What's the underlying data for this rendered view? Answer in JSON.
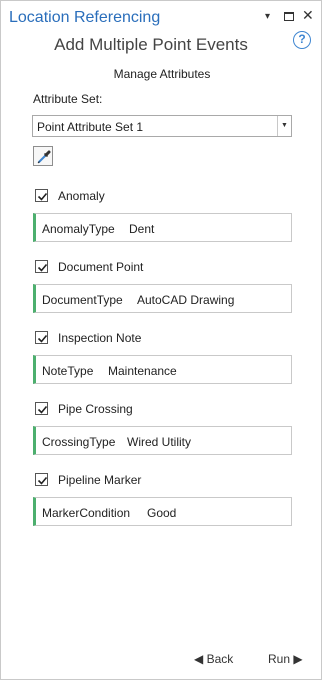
{
  "pane": {
    "title": "Location Referencing",
    "menu_glyph": "▾",
    "close_glyph": "✕"
  },
  "tool": {
    "title": "Add Multiple Point Events",
    "help_glyph": "?"
  },
  "manage": {
    "heading": "Manage Attributes",
    "attribute_set_label": "Attribute Set:",
    "attribute_set_value": "Point Attribute Set 1",
    "dropdown_glyph": "▼"
  },
  "events": [
    {
      "label": "Anomaly",
      "checked": true,
      "field": "AnomalyType",
      "value": "Dent"
    },
    {
      "label": "Document Point",
      "checked": true,
      "field": "DocumentType",
      "value": "AutoCAD Drawing"
    },
    {
      "label": "Inspection Note",
      "checked": true,
      "field": "NoteType",
      "value": "Maintenance"
    },
    {
      "label": "Pipe Crossing",
      "checked": true,
      "field": "CrossingType",
      "value": "Wired Utility"
    },
    {
      "label": "Pipeline Marker",
      "checked": true,
      "field": "MarkerCondition",
      "value": "Good"
    }
  ],
  "footer": {
    "back_label": "◀ Back",
    "run_label": "Run ▶"
  },
  "colors": {
    "title_blue": "#2a6ebb",
    "required_field_marker": "#4caf6e",
    "help_blue": "#3f86d1"
  }
}
